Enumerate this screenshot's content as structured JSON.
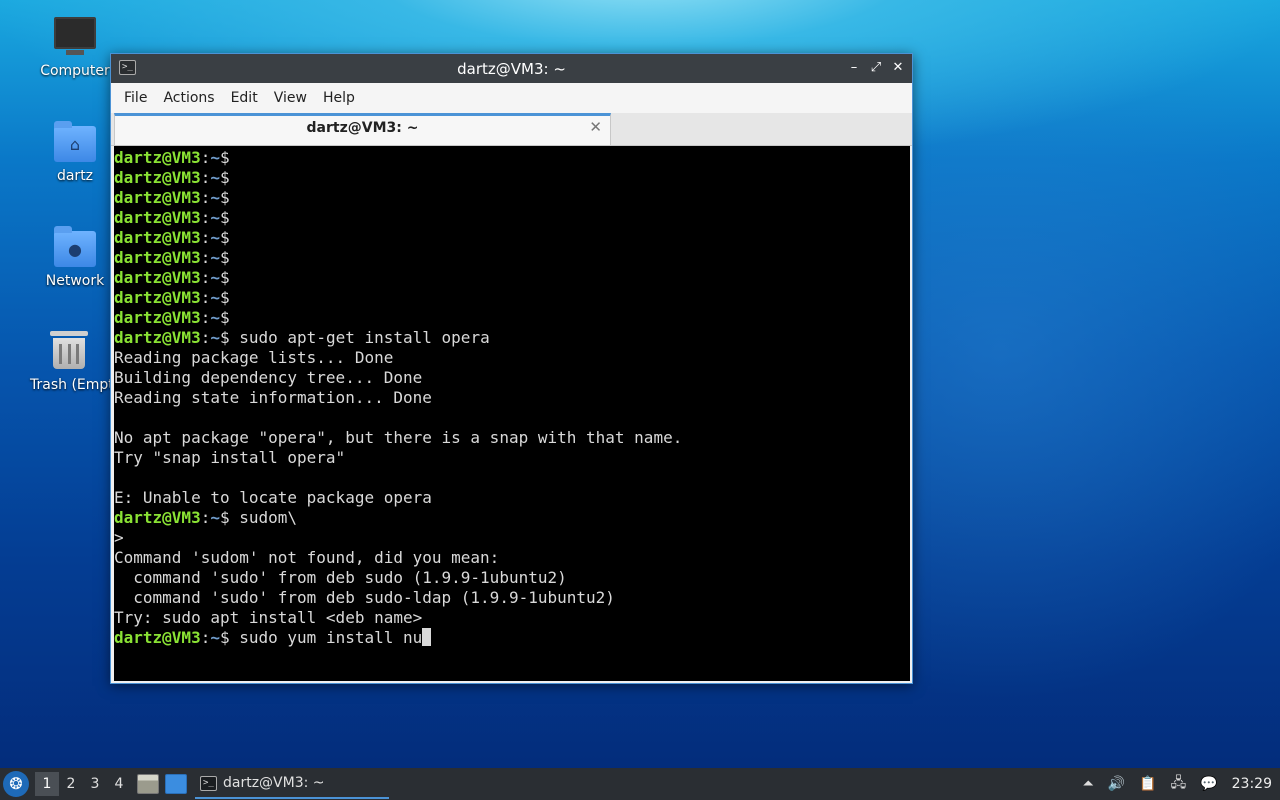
{
  "desktop": {
    "icons": [
      {
        "label": "Computer",
        "icon": "monitor-icon"
      },
      {
        "label": "dartz",
        "icon": "home-folder-icon"
      },
      {
        "label": "Network",
        "icon": "network-folder-icon"
      },
      {
        "label": "Trash (Empt",
        "icon": "trash-icon"
      }
    ]
  },
  "window": {
    "title": "dartz@VM3: ~",
    "app_icon_glyph": ">_",
    "controls": {
      "minimize": "–",
      "maximize": "⤢",
      "close": "✕"
    },
    "menu": [
      "File",
      "Actions",
      "Edit",
      "View",
      "Help"
    ],
    "tab": {
      "label": "dartz@VM3: ~",
      "close": "✕"
    }
  },
  "terminal": {
    "prompt_user": "dartz@VM3",
    "prompt_sep": ":",
    "prompt_path": "~",
    "prompt_dollar": "$ ",
    "lines": [
      {
        "type": "prompt",
        "cmd": ""
      },
      {
        "type": "prompt",
        "cmd": ""
      },
      {
        "type": "prompt",
        "cmd": ""
      },
      {
        "type": "prompt",
        "cmd": ""
      },
      {
        "type": "prompt",
        "cmd": ""
      },
      {
        "type": "prompt",
        "cmd": ""
      },
      {
        "type": "prompt",
        "cmd": ""
      },
      {
        "type": "prompt",
        "cmd": ""
      },
      {
        "type": "prompt",
        "cmd": ""
      },
      {
        "type": "prompt",
        "cmd": "sudo apt-get install opera"
      },
      {
        "type": "out",
        "text": "Reading package lists... Done"
      },
      {
        "type": "out",
        "text": "Building dependency tree... Done"
      },
      {
        "type": "out",
        "text": "Reading state information... Done"
      },
      {
        "type": "out",
        "text": ""
      },
      {
        "type": "out",
        "text": "No apt package \"opera\", but there is a snap with that name."
      },
      {
        "type": "out",
        "text": "Try \"snap install opera\""
      },
      {
        "type": "out",
        "text": ""
      },
      {
        "type": "out",
        "text": "E: Unable to locate package opera"
      },
      {
        "type": "prompt",
        "cmd": "sudom\\"
      },
      {
        "type": "out",
        "text": ">"
      },
      {
        "type": "out",
        "text": "Command 'sudom' not found, did you mean:"
      },
      {
        "type": "out",
        "text": "  command 'sudo' from deb sudo (1.9.9-1ubuntu2)"
      },
      {
        "type": "out",
        "text": "  command 'sudo' from deb sudo-ldap (1.9.9-1ubuntu2)"
      },
      {
        "type": "out",
        "text": "Try: sudo apt install <deb name>"
      },
      {
        "type": "prompt",
        "cmd": "sudo yum install nu",
        "cursor": true
      }
    ]
  },
  "taskbar": {
    "start_icon": "start-menu-icon",
    "workspaces": [
      "1",
      "2",
      "3",
      "4"
    ],
    "active_workspace": "1",
    "task_label": "dartz@VM3: ~",
    "tray_icons": [
      "tray-up-icon",
      "volume-icon",
      "clipboard-icon",
      "network-icon",
      "notification-icon"
    ],
    "clock": "23:29"
  }
}
